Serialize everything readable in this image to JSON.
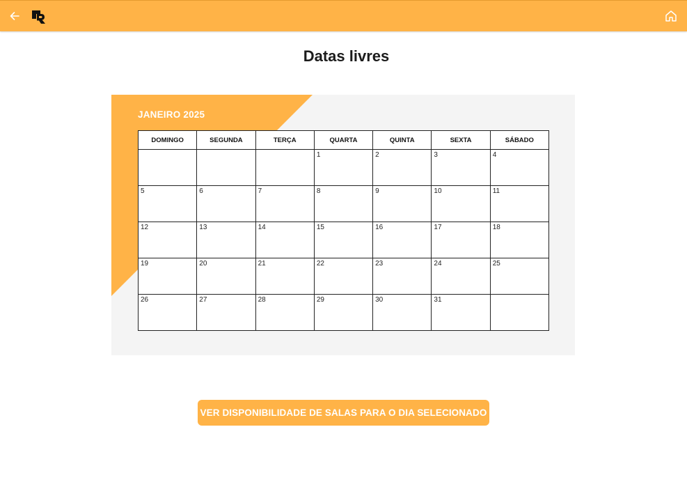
{
  "header": {
    "back_icon": "arrow-left-icon",
    "logo_icon": "brand-logo-icon",
    "home_icon": "home-icon",
    "background_color": "#FFB347"
  },
  "page": {
    "title": "Datas livres"
  },
  "calendar": {
    "month_label": "JANEIRO 2025",
    "accent_color": "#FFB347",
    "weekdays": [
      "DOMINGO",
      "SEGUNDA",
      "TERÇA",
      "QUARTA",
      "QUINTA",
      "SEXTA",
      "SÁBADO"
    ],
    "weeks": [
      [
        "",
        "",
        "",
        "1",
        "2",
        "3",
        "4"
      ],
      [
        "5",
        "6",
        "7",
        "8",
        "9",
        "10",
        "11"
      ],
      [
        "12",
        "13",
        "14",
        "15",
        "16",
        "17",
        "18"
      ],
      [
        "19",
        "20",
        "21",
        "22",
        "23",
        "24",
        "25"
      ],
      [
        "26",
        "27",
        "28",
        "29",
        "30",
        "31",
        ""
      ]
    ]
  },
  "actions": {
    "check_availability_label": "VER DISPONIBILIDADE DE SALAS PARA O DIA SELECIONADO",
    "button_color": "#FFB347"
  }
}
